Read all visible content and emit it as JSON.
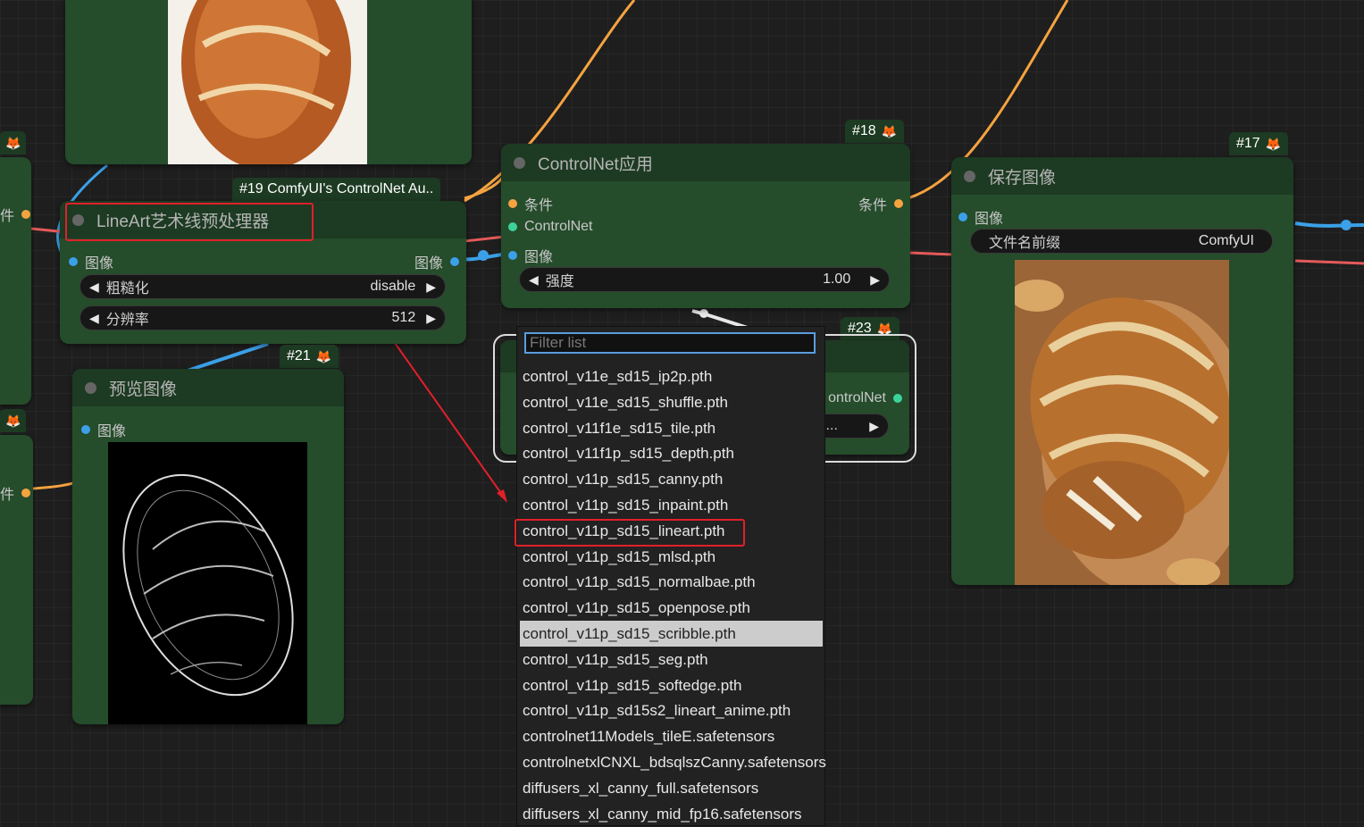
{
  "nodes": {
    "lineart": {
      "badge": "#19 ComfyUI's ControlNet Au..",
      "title": "LineArt艺术线预处理器",
      "in_image": "图像",
      "out_image": "图像",
      "w1_label": "粗糙化",
      "w1_value": "disable",
      "w2_label": "分辨率",
      "w2_value": "512"
    },
    "preview": {
      "badge": "#21",
      "title": "预览图像",
      "in_image": "图像"
    },
    "controlnet": {
      "badge": "#18",
      "title": "ControlNet应用",
      "in_cond": "条件",
      "out_cond": "条件",
      "in_controlnet": "ControlNet",
      "in_image": "图像",
      "w_label": "强度",
      "w_value": "1.00"
    },
    "loader": {
      "badge": "#23",
      "out_partial": "ontrolNet",
      "widget_partial": "i..."
    },
    "save": {
      "badge": "#17",
      "title": "保存图像",
      "in_image": "图像",
      "w_label": "文件名前缀",
      "w_value": "ComfyUI"
    },
    "left_partial": {
      "slot_a": "件",
      "slot_b": "件"
    }
  },
  "dropdown": {
    "placeholder": "Filter list",
    "selected": "control_v11p_sd15_scribble.pth",
    "highlighted_by_annotation": "control_v11p_sd15_lineart.pth",
    "options": [
      "control_v11e_sd15_ip2p.pth",
      "control_v11e_sd15_shuffle.pth",
      "control_v11f1e_sd15_tile.pth",
      "control_v11f1p_sd15_depth.pth",
      "control_v11p_sd15_canny.pth",
      "control_v11p_sd15_inpaint.pth",
      "control_v11p_sd15_lineart.pth",
      "control_v11p_sd15_mlsd.pth",
      "control_v11p_sd15_normalbae.pth",
      "control_v11p_sd15_openpose.pth",
      "control_v11p_sd15_scribble.pth",
      "control_v11p_sd15_seg.pth",
      "control_v11p_sd15_softedge.pth",
      "control_v11p_sd15s2_lineart_anime.pth",
      "controlnet11Models_tileE.safetensors",
      "controlnetxlCNXL_bdsqlszCanny.safetensors",
      "diffusers_xl_canny_full.safetensors",
      "diffusers_xl_canny_mid_fp16.safetensors"
    ]
  },
  "colors": {
    "canvas": "#1e1e1e",
    "node_body": "#254c2b",
    "node_title": "#1d3a22",
    "wire_orange": "#f5a340",
    "wire_blue": "#3ba0e8",
    "wire_red": "#e45a5a",
    "annotation_red": "#e0202a"
  },
  "icons": {
    "node_badge": "fox-icon",
    "widget_left": "arrow-left-icon",
    "widget_right": "arrow-right-icon"
  }
}
